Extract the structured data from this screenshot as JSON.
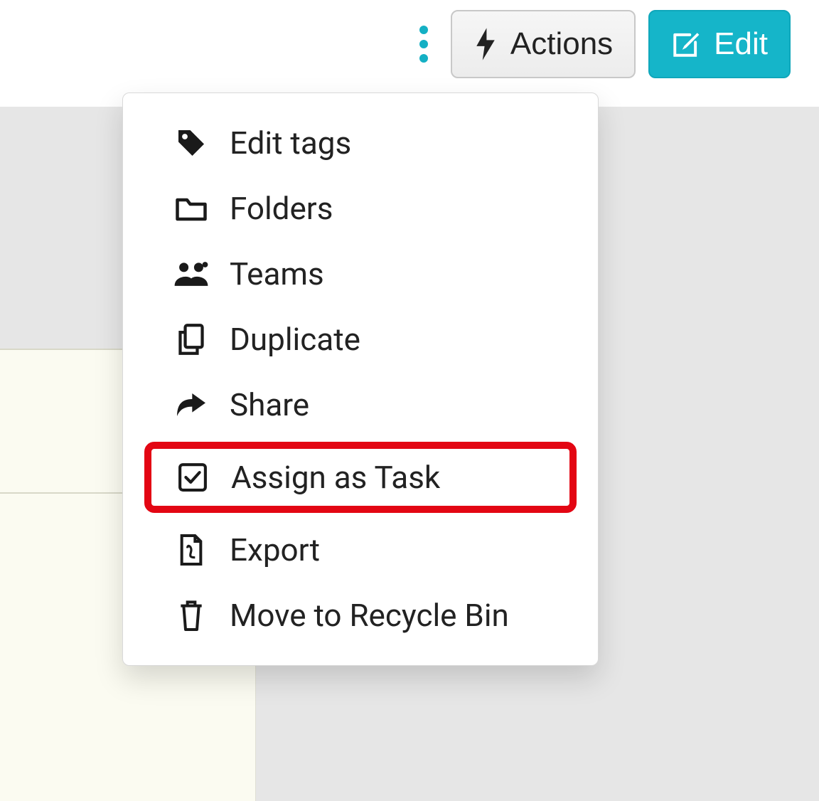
{
  "toolbar": {
    "actions_label": "Actions",
    "edit_label": "Edit"
  },
  "menu": {
    "items": [
      {
        "icon": "tag-icon",
        "label": "Edit tags"
      },
      {
        "icon": "folder-icon",
        "label": "Folders"
      },
      {
        "icon": "users-icon",
        "label": "Teams"
      },
      {
        "icon": "copy-icon",
        "label": "Duplicate"
      },
      {
        "icon": "share-icon",
        "label": "Share"
      },
      {
        "icon": "check-square-icon",
        "label": "Assign as Task",
        "highlighted": true
      },
      {
        "icon": "file-pdf-icon",
        "label": "Export"
      },
      {
        "icon": "trash-icon",
        "label": "Move to Recycle Bin"
      }
    ]
  },
  "colors": {
    "accent": "#15b5c9",
    "highlight_border": "#e30613"
  }
}
